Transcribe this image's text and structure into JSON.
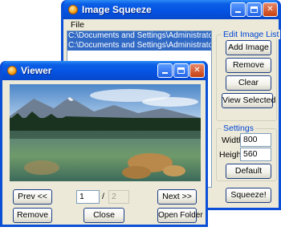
{
  "main_window": {
    "title": "Image Squeeze",
    "menu": [
      "File"
    ],
    "file_list": [
      "C:\\Documents and Settings\\Administrator\\Desktop\\",
      "C:\\Documents and Settings\\Administrator\\Desktop\\"
    ],
    "edit_group": {
      "title": "Edit Image List",
      "add": "Add Image",
      "remove": "Remove",
      "clear": "Clear",
      "view_selected": "View Selected"
    },
    "settings_group": {
      "title": "Settings",
      "width_label": "Width",
      "width_value": "800",
      "height_label": "Height",
      "height_value": "560",
      "default": "Default"
    },
    "squeeze": "Squeeze!"
  },
  "viewer": {
    "title": "Viewer",
    "prev": "Prev <<",
    "next": "Next >>",
    "page_current": "1",
    "page_sep": "/",
    "page_total": "2",
    "remove": "Remove",
    "close": "Close",
    "open_folder": "Open Folder"
  },
  "colors": {
    "titlebar": "#0554e3",
    "window_face": "#ece9d8",
    "selection": "#316ac5",
    "group_title": "#0046d5"
  }
}
